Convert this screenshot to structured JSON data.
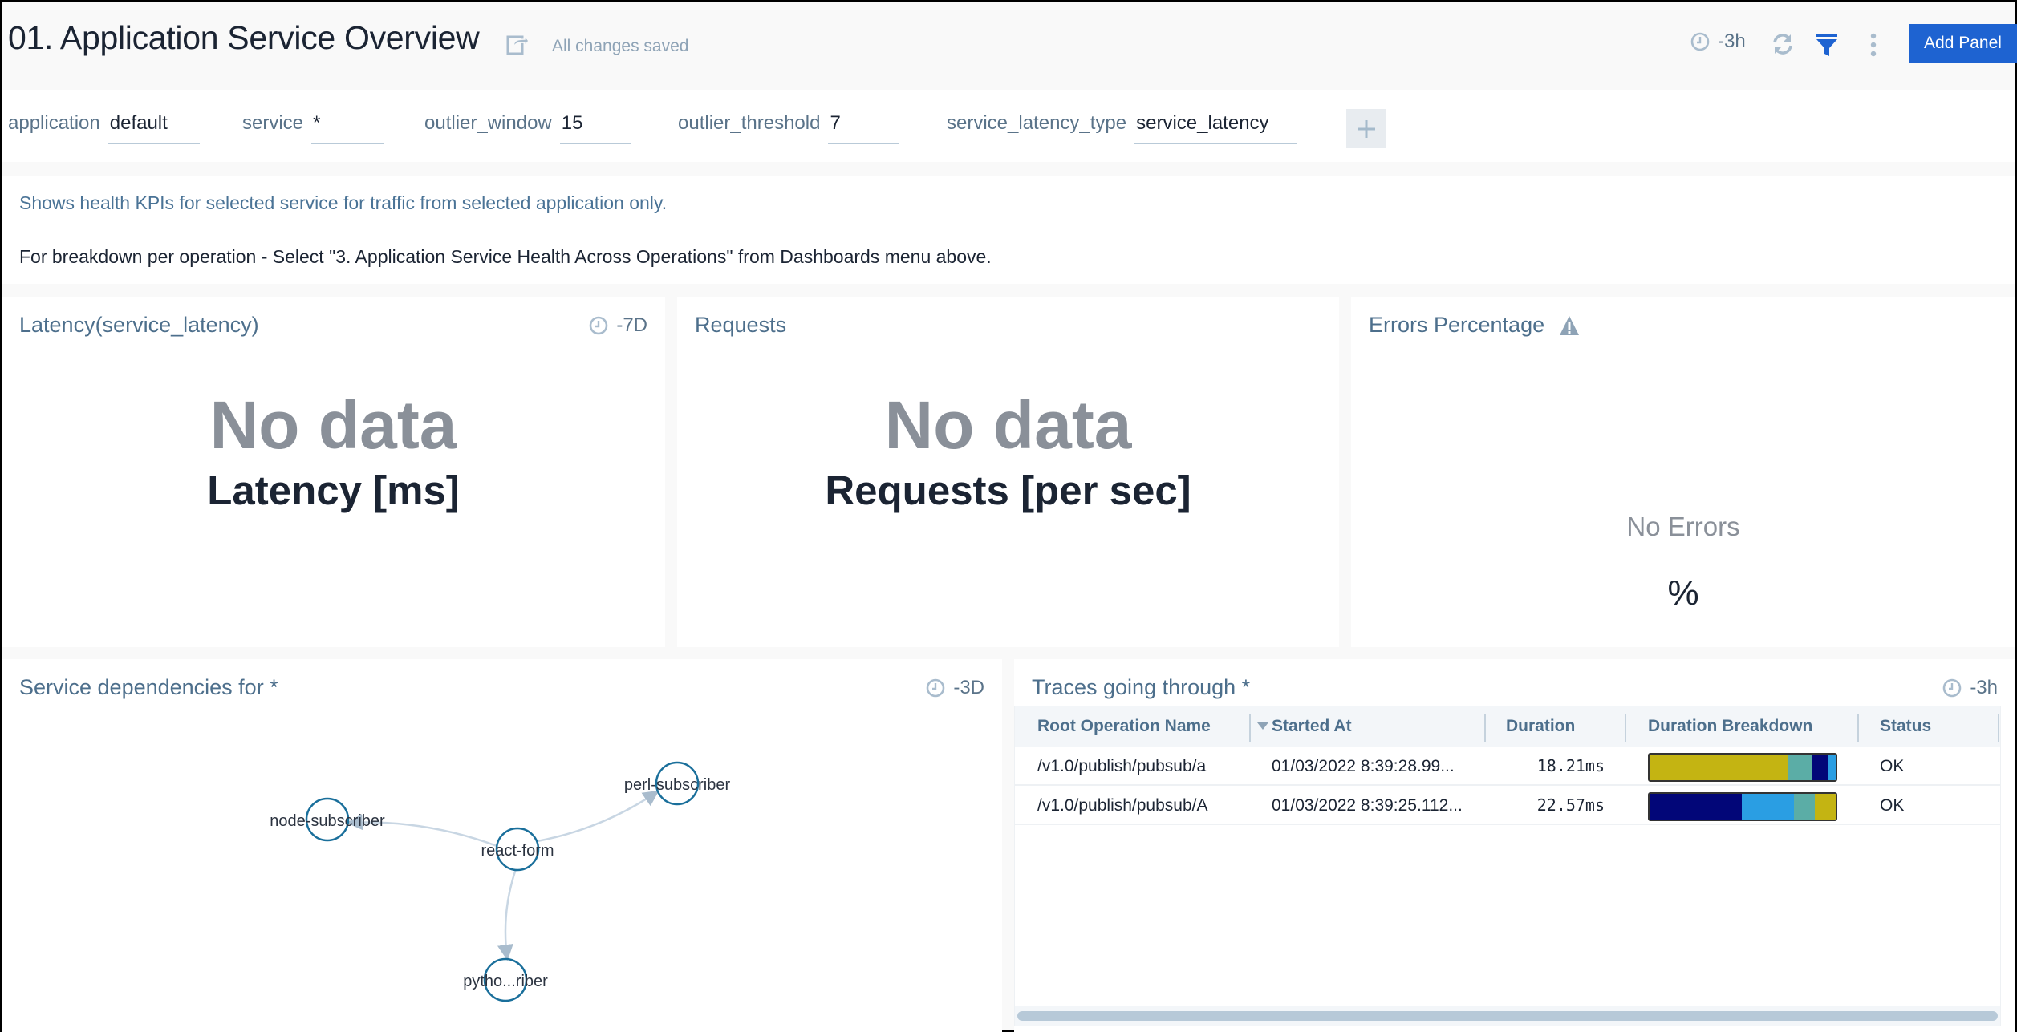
{
  "header": {
    "title": "01. Application Service Overview",
    "save_status": "All changes saved",
    "time_range": "-3h",
    "add_panel_label": "Add Panel",
    "icons": [
      "share-icon",
      "clock-icon",
      "refresh-icon",
      "filter-icon",
      "more-vertical-icon"
    ]
  },
  "variables": [
    {
      "label": "application",
      "value": "default"
    },
    {
      "label": "service",
      "value": "*"
    },
    {
      "label": "outlier_window",
      "value": "15"
    },
    {
      "label": "outlier_threshold",
      "value": "7"
    },
    {
      "label": "service_latency_type",
      "value": "service_latency"
    }
  ],
  "add_variable_label": "+",
  "description": {
    "line1": "Shows health KPIs for selected service for traffic from selected application only.",
    "line2": "For breakdown per operation - Select \"3. Application Service Health Across Operations\" from Dashboards menu above."
  },
  "panels": {
    "latency": {
      "title": "Latency(service_latency)",
      "time_range": "-7D",
      "value": "No data",
      "unit": "Latency [ms]"
    },
    "requests": {
      "title": "Requests",
      "value": "No data",
      "unit": "Requests [per sec]"
    },
    "errors": {
      "title": "Errors Percentage",
      "value": "No Errors",
      "unit": "%"
    },
    "dependencies": {
      "title": "Service dependencies for *",
      "time_range": "-3D",
      "nodes": [
        {
          "id": "react-form",
          "label": "react-form"
        },
        {
          "id": "node-subscriber",
          "label": "node-subscriber"
        },
        {
          "id": "perl-subscriber",
          "label": "perl-subscriber"
        },
        {
          "id": "python-subscriber",
          "label": "pytho...riber"
        }
      ],
      "edges": [
        {
          "from": "react-form",
          "to": "node-subscriber"
        },
        {
          "from": "react-form",
          "to": "perl-subscriber"
        },
        {
          "from": "react-form",
          "to": "python-subscriber"
        }
      ]
    },
    "traces": {
      "title": "Traces going through *",
      "time_range": "-3h",
      "columns": [
        "Root Operation Name",
        "Started At",
        "Duration",
        "Duration Breakdown",
        "Status"
      ],
      "sort_column": "Started At",
      "rows": [
        {
          "operation": "/v1.0/publish/pubsub/a",
          "started_at": "01/03/2022 8:39:28.99...",
          "duration": "18.21ms",
          "breakdown": [
            {
              "fraction": 0.74,
              "color": "#c4b412"
            },
            {
              "fraction": 0.135,
              "color": "#5bada6"
            },
            {
              "fraction": 0.08,
              "color": "#020678"
            },
            {
              "fraction": 0.045,
              "color": "#2a9ee3"
            }
          ],
          "status": "OK"
        },
        {
          "operation": "/v1.0/publish/pubsub/A",
          "started_at": "01/03/2022 8:39:25.112...",
          "duration": "22.57ms",
          "breakdown": [
            {
              "fraction": 0.495,
              "color": "#020678"
            },
            {
              "fraction": 0.28,
              "color": "#2a9ee3"
            },
            {
              "fraction": 0.115,
              "color": "#5bada6"
            },
            {
              "fraction": 0.11,
              "color": "#c4b412"
            }
          ],
          "status": "OK"
        }
      ]
    }
  },
  "colors": {
    "accent": "#1e63d1",
    "panel_title": "#4d6f8c",
    "node_stroke": "#1a6f9b",
    "edge": "#c8d6e3"
  }
}
